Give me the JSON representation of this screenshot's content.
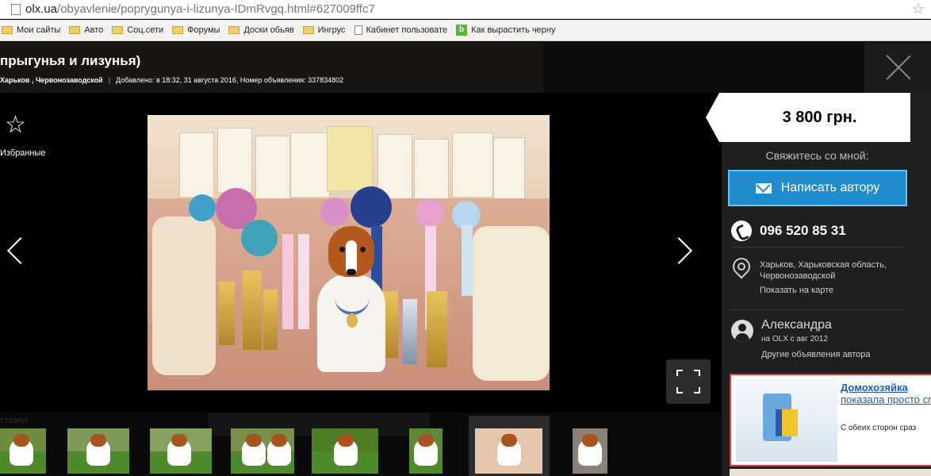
{
  "browser": {
    "url_domain": "olx.ua",
    "url_path": "/obyavlenie/poprygunya-i-lizunya-IDmRvgq.html#627009ffc7",
    "bookmarks": [
      {
        "type": "folder",
        "label": "Мои сайты"
      },
      {
        "type": "folder",
        "label": "Авто"
      },
      {
        "type": "folder",
        "label": "Соц.сети"
      },
      {
        "type": "folder",
        "label": "Форумы"
      },
      {
        "type": "folder",
        "label": "Доски обьяв"
      },
      {
        "type": "folder",
        "label": "Ингрус"
      },
      {
        "type": "page",
        "label": "Кабинет пользовате"
      },
      {
        "type": "b",
        "label": "Как вырастить черну"
      }
    ]
  },
  "listing": {
    "title": "прыгунья и лизунья)",
    "location": "Харьков , Червонозаводской",
    "added": "Добавлено: в 18:32, 31 августа 2016, Номер объявления: 337834802",
    "favorite_label": "Избранные",
    "thumb_hint": "ставку!"
  },
  "sidebar": {
    "price": "3 800 грн.",
    "contact_label": "Свяжитесь со мной:",
    "write_button": "Написать автору",
    "phone": "096 520 85 31",
    "location_text": "Харьков, Харьковская область, Червонозаводской",
    "map_link": "Показать на карте",
    "user_name": "Александра",
    "user_since": "на OLX с авг 2012",
    "user_link": "Другие объявления автора"
  },
  "ad": {
    "title": "Домохозяйка",
    "subtitle": "показала просто способ мыть окн",
    "description": "С обеих сторон сраз"
  },
  "colors": {
    "accent": "#1e8ccf",
    "ad_link": "#1f5cb5"
  }
}
